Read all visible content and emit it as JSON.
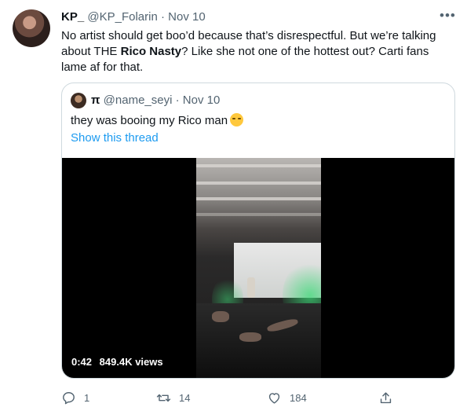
{
  "tweet": {
    "author_name": "KP_",
    "author_handle": "@KP_Folarin",
    "separator": "·",
    "date": "Nov 10",
    "more_label": "•••",
    "text_part1": "No artist should get boo’d because that’s disrespectful. But we’re talking about THE ",
    "text_bold": "Rico Nasty",
    "text_part2": "? Like she not one of the hottest out? Carti fans lame af for that."
  },
  "quoted": {
    "author_name": "π",
    "author_handle": "@name_seyi",
    "separator": "·",
    "date": "Nov 10",
    "text": "they was booing my Rico man",
    "show_thread": "Show this thread",
    "video": {
      "duration": "0:42",
      "views": "849.4K views"
    }
  },
  "actions": {
    "reply_count": "1",
    "retweet_count": "14",
    "like_count": "184"
  },
  "colors": {
    "link": "#1d9bf0",
    "muted": "#536471",
    "border": "#cfd9de"
  }
}
